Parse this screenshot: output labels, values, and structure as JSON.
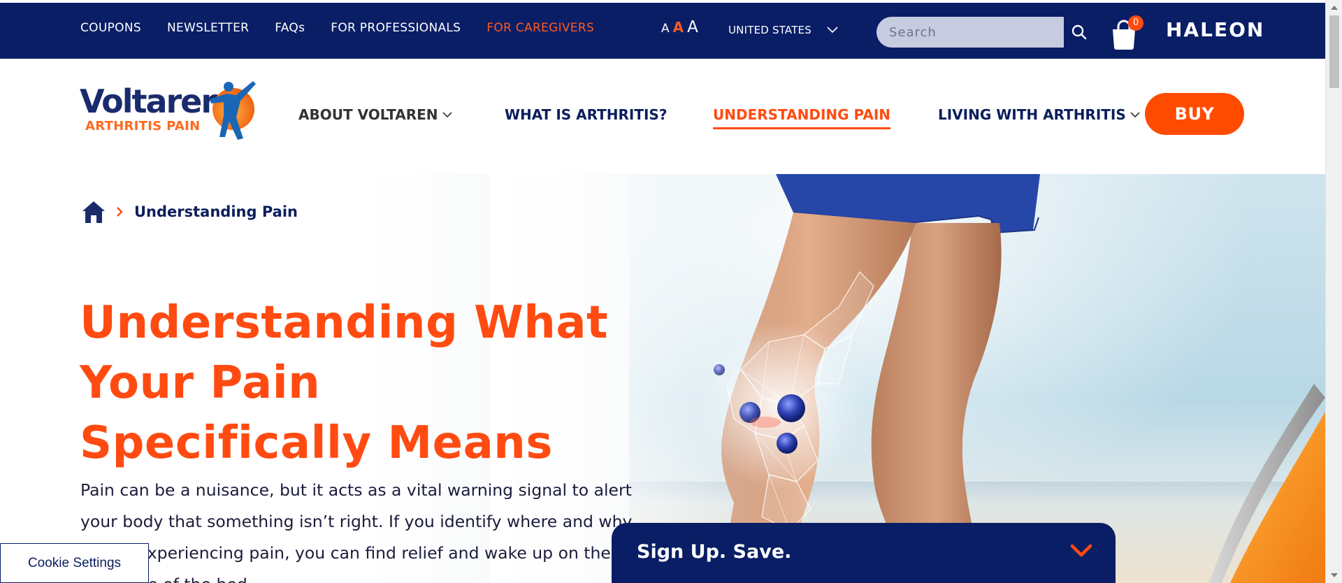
{
  "topbar": {
    "nav": [
      {
        "label": "COUPONS",
        "active": false
      },
      {
        "label": "NEWSLETTER",
        "active": false
      },
      {
        "label": "FAQs",
        "active": false
      },
      {
        "label": "FOR PROFESSIONALS",
        "active": false
      },
      {
        "label": "FOR CAREGIVERS",
        "active": true
      }
    ],
    "font_size_controls": [
      "A",
      "A",
      "A"
    ],
    "country": "UNITED STATES",
    "search_placeholder": "Search",
    "cart_count": "0",
    "corporate_logo": "HALEON"
  },
  "header": {
    "logo": {
      "brand": "Voltaren",
      "sub": "ARTHRITIS PAIN"
    },
    "nav": [
      {
        "label": "ABOUT VOLTAREN",
        "dropdown": true,
        "active": false
      },
      {
        "label": "WHAT IS ARTHRITIS?",
        "dropdown": false,
        "active": false
      },
      {
        "label": "UNDERSTANDING PAIN",
        "dropdown": false,
        "active": true
      },
      {
        "label": "LIVING WITH ARTHRITIS",
        "dropdown": true,
        "active": false
      }
    ],
    "buy_label": "BUY"
  },
  "hero": {
    "breadcrumb": {
      "current": "Understanding Pain"
    },
    "title": "Understanding What Your Pain Specifically Means",
    "intro": "Pain can be a nuisance, but it acts as a vital warning signal to alert your body that something isn’t right. If you identify where and why you’re experiencing pain, you can find relief and wake up on the right side of the bed."
  },
  "overlays": {
    "cookie_settings": "Cookie Settings",
    "signup": "Sign Up. Save."
  },
  "colors": {
    "navy": "#0a1e66",
    "orange": "#ff4b12",
    "text": "#1c1c3c"
  }
}
